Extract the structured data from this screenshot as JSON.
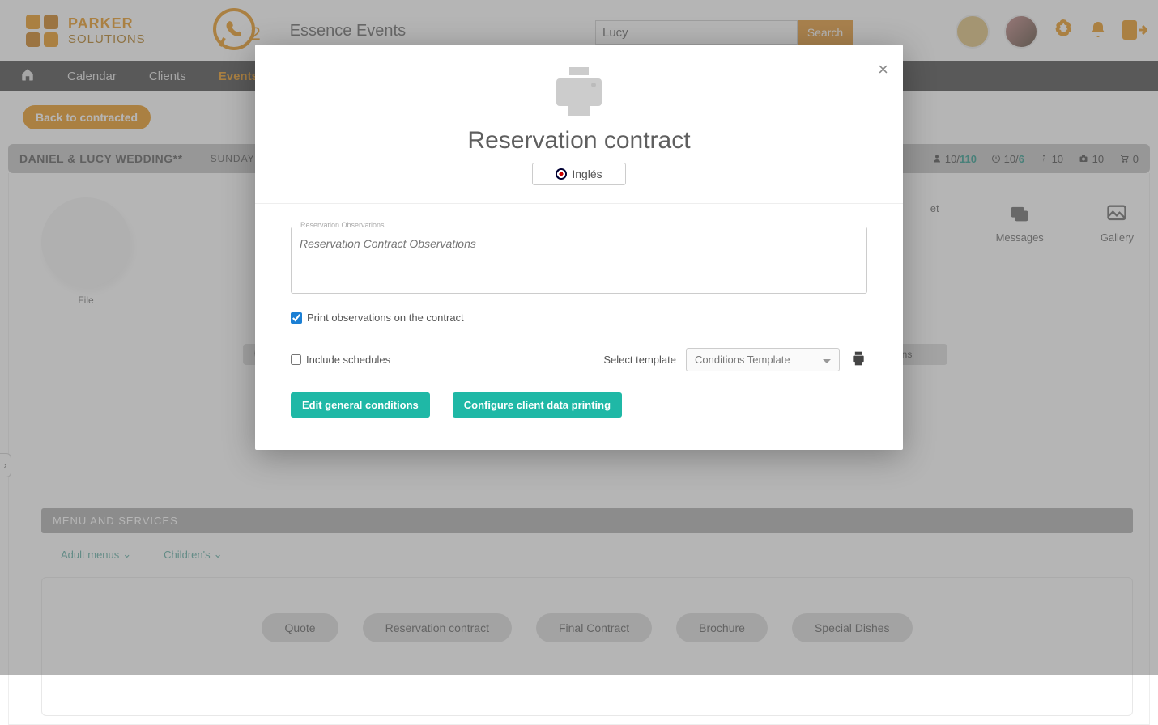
{
  "header": {
    "logo_line1": "PARKER",
    "logo_line2": "SOLUTIONS",
    "whatsapp_badge": "2",
    "company": "Essence Events",
    "search_value": "Lucy",
    "search_button": "Search"
  },
  "nav": {
    "items": [
      "Calendar",
      "Clients",
      "Events"
    ]
  },
  "page": {
    "back_button": "Back to contracted",
    "event_title": "DANIEL & LUCY WEDDING**",
    "event_day": "SUNDAY",
    "stat_people": "10",
    "stat_people_total": "110",
    "stat_clock": "10",
    "stat_clock_total": "6",
    "stat_walk": "10",
    "stat_camera": "10",
    "stat_cart": "0",
    "file_label": "File",
    "chip_big_label": "ns",
    "messages_label": "Messages",
    "gallery_label": "Gallery",
    "partial_label": "et",
    "section_title": "MENU AND SERVICES",
    "tabs": [
      "Adult menus",
      "Children's"
    ],
    "pills": [
      "Quote",
      "Reservation contract",
      "Final Contract",
      "Brochure",
      "Special Dishes"
    ]
  },
  "modal": {
    "title": "Reservation contract",
    "language": "Inglés",
    "obs_legend": "Reservation Observations",
    "obs_placeholder": "Reservation Contract Observations",
    "print_obs_label": "Print observations on the contract",
    "include_sched_label": "Include schedules",
    "select_template_label": "Select template",
    "template_value": "Conditions Template",
    "btn_edit": "Edit general conditions",
    "btn_configure": "Configure client data printing"
  }
}
